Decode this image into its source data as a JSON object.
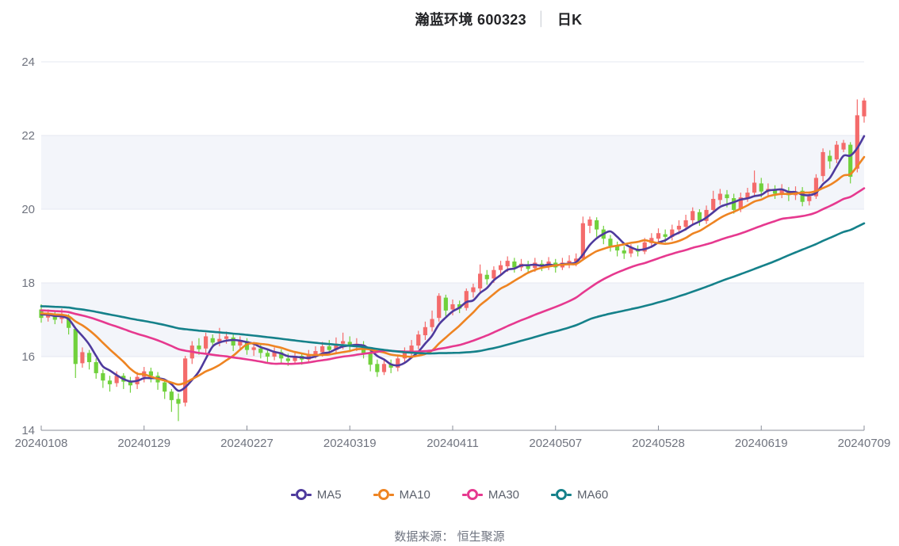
{
  "title": {
    "stock": "瀚蓝环境 600323",
    "separator": "│",
    "period": "日K"
  },
  "footer": {
    "source_label": "数据来源： 恒生聚源"
  },
  "legend": {
    "items": [
      {
        "label": "MA5",
        "color": "#4e3a9d"
      },
      {
        "label": "MA10",
        "color": "#ee8422"
      },
      {
        "label": "MA30",
        "color": "#e6398f"
      },
      {
        "label": "MA60",
        "color": "#15818a"
      }
    ]
  },
  "chart_data": {
    "type": "candlestick",
    "title": "瀚蓝环境 600323 日K",
    "legend_entries": [
      "MA5",
      "MA10",
      "MA30",
      "MA60"
    ],
    "y_axis": {
      "min": 14,
      "max": 24,
      "ticks": [
        14,
        16,
        18,
        20,
        22,
        24
      ],
      "tick_labels": [
        "14",
        "16",
        "18",
        "20",
        "22",
        "24"
      ]
    },
    "x_axis": {
      "tick_labels": [
        "20240108",
        "20240129",
        "20240227",
        "20240319",
        "20240411",
        "20240507",
        "20240528",
        "20240619",
        "20240709"
      ],
      "tick_indices": [
        0,
        15,
        30,
        45,
        60,
        75,
        90,
        105,
        120
      ]
    },
    "stripe_bands": [
      [
        16,
        18
      ],
      [
        20,
        22
      ]
    ],
    "grid_on": true,
    "legend_position": "bottom",
    "colors": {
      "up": "#f46b6b",
      "down": "#70d13c",
      "stripe": "#f3f5fa",
      "grid": "#e4e8f1",
      "axis": "#898e99",
      "label": "#70747f"
    },
    "candles_format": [
      "open",
      "close",
      "low",
      "high"
    ],
    "candles": [
      [
        17.28,
        17.05,
        16.92,
        17.42
      ],
      [
        17.06,
        17.15,
        16.95,
        17.28
      ],
      [
        17.15,
        17.0,
        16.88,
        17.22
      ],
      [
        17.02,
        17.1,
        16.9,
        17.3
      ],
      [
        17.08,
        16.78,
        16.6,
        17.15
      ],
      [
        16.75,
        15.8,
        15.42,
        16.8
      ],
      [
        15.82,
        16.12,
        15.7,
        16.25
      ],
      [
        16.1,
        15.85,
        15.65,
        16.18
      ],
      [
        15.85,
        15.55,
        15.4,
        15.95
      ],
      [
        15.55,
        15.35,
        15.15,
        15.65
      ],
      [
        15.35,
        15.25,
        15.05,
        15.48
      ],
      [
        15.28,
        15.48,
        15.18,
        15.6
      ],
      [
        15.48,
        15.32,
        15.12,
        15.55
      ],
      [
        15.32,
        15.22,
        15.02,
        15.45
      ],
      [
        15.25,
        15.45,
        15.12,
        15.58
      ],
      [
        15.45,
        15.6,
        15.3,
        15.72
      ],
      [
        15.6,
        15.48,
        15.3,
        15.7
      ],
      [
        15.48,
        15.3,
        15.1,
        15.58
      ],
      [
        15.3,
        15.05,
        14.85,
        15.4
      ],
      [
        15.05,
        14.82,
        14.5,
        15.12
      ],
      [
        14.85,
        14.72,
        14.25,
        15.0
      ],
      [
        14.75,
        15.95,
        14.65,
        16.02
      ],
      [
        15.95,
        16.3,
        15.8,
        16.42
      ],
      [
        16.3,
        16.2,
        16.05,
        16.5
      ],
      [
        16.22,
        16.55,
        16.1,
        16.65
      ],
      [
        16.5,
        16.38,
        16.25,
        16.6
      ],
      [
        16.4,
        16.48,
        16.28,
        16.78
      ],
      [
        16.48,
        16.55,
        16.35,
        16.68
      ],
      [
        16.52,
        16.3,
        16.15,
        16.6
      ],
      [
        16.3,
        16.45,
        16.2,
        16.55
      ],
      [
        16.42,
        16.18,
        16.05,
        16.5
      ],
      [
        16.18,
        16.25,
        16.02,
        16.4
      ],
      [
        16.22,
        16.1,
        15.95,
        16.32
      ],
      [
        16.1,
        16.0,
        15.85,
        16.22
      ],
      [
        16.0,
        16.12,
        15.9,
        16.25
      ],
      [
        16.12,
        15.95,
        15.8,
        16.2
      ],
      [
        15.95,
        15.88,
        15.75,
        16.08
      ],
      [
        15.88,
        16.02,
        15.8,
        16.12
      ],
      [
        16.02,
        15.92,
        15.78,
        16.1
      ],
      [
        15.92,
        16.05,
        15.82,
        16.18
      ],
      [
        16.05,
        16.15,
        15.95,
        16.28
      ],
      [
        16.12,
        16.28,
        16.0,
        16.4
      ],
      [
        16.28,
        16.18,
        16.05,
        16.45
      ],
      [
        16.18,
        16.35,
        16.08,
        16.52
      ],
      [
        16.35,
        16.42,
        16.2,
        16.65
      ],
      [
        16.4,
        16.28,
        16.12,
        16.55
      ],
      [
        16.28,
        16.35,
        16.15,
        16.5
      ],
      [
        16.32,
        16.1,
        15.95,
        16.42
      ],
      [
        16.1,
        15.78,
        15.6,
        16.18
      ],
      [
        15.8,
        15.58,
        15.45,
        15.92
      ],
      [
        15.58,
        15.8,
        15.5,
        15.95
      ],
      [
        15.8,
        15.7,
        15.55,
        15.92
      ],
      [
        15.7,
        15.95,
        15.6,
        16.05
      ],
      [
        15.95,
        16.12,
        15.85,
        16.25
      ],
      [
        16.12,
        16.3,
        16.0,
        16.45
      ],
      [
        16.3,
        16.6,
        16.2,
        16.7
      ],
      [
        16.58,
        16.8,
        16.45,
        16.95
      ],
      [
        16.8,
        17.02,
        16.68,
        17.25
      ],
      [
        17.05,
        17.65,
        16.95,
        17.72
      ],
      [
        17.6,
        17.25,
        17.1,
        17.68
      ],
      [
        17.28,
        17.42,
        17.12,
        17.55
      ],
      [
        17.42,
        17.3,
        17.18,
        17.52
      ],
      [
        17.32,
        17.78,
        17.25,
        17.85
      ],
      [
        17.75,
        17.88,
        17.6,
        17.98
      ],
      [
        17.85,
        18.25,
        17.75,
        18.5
      ],
      [
        18.22,
        18.1,
        17.95,
        18.35
      ],
      [
        18.12,
        18.35,
        18.0,
        18.45
      ],
      [
        18.35,
        18.48,
        18.22,
        18.6
      ],
      [
        18.45,
        18.6,
        18.3,
        18.72
      ],
      [
        18.58,
        18.42,
        18.28,
        18.68
      ],
      [
        18.42,
        18.52,
        18.32,
        18.65
      ],
      [
        18.5,
        18.38,
        18.25,
        18.6
      ],
      [
        18.4,
        18.55,
        18.3,
        18.68
      ],
      [
        18.52,
        18.45,
        18.32,
        18.62
      ],
      [
        18.45,
        18.58,
        18.35,
        18.7
      ],
      [
        18.55,
        18.42,
        18.28,
        18.65
      ],
      [
        18.42,
        18.55,
        18.35,
        18.68
      ],
      [
        18.52,
        18.6,
        18.4,
        18.75
      ],
      [
        18.58,
        18.66,
        18.45,
        18.8
      ],
      [
        18.66,
        19.62,
        18.6,
        19.8
      ],
      [
        19.55,
        19.72,
        19.35,
        19.8
      ],
      [
        19.7,
        19.45,
        19.25,
        19.78
      ],
      [
        19.45,
        19.2,
        19.05,
        19.55
      ],
      [
        19.2,
        19.0,
        18.85,
        19.3
      ],
      [
        19.0,
        18.88,
        18.72,
        19.12
      ],
      [
        18.88,
        18.8,
        18.65,
        19.0
      ],
      [
        18.8,
        18.95,
        18.7,
        19.05
      ],
      [
        18.92,
        18.85,
        18.72,
        19.02
      ],
      [
        18.85,
        19.1,
        18.78,
        19.22
      ],
      [
        19.08,
        19.22,
        18.95,
        19.35
      ],
      [
        19.2,
        19.35,
        19.08,
        19.48
      ],
      [
        19.32,
        19.25,
        19.1,
        19.45
      ],
      [
        19.25,
        19.45,
        19.15,
        19.58
      ],
      [
        19.45,
        19.55,
        19.32,
        19.7
      ],
      [
        19.52,
        19.7,
        19.42,
        19.85
      ],
      [
        19.7,
        19.95,
        19.6,
        20.05
      ],
      [
        19.92,
        19.68,
        19.55,
        20.0
      ],
      [
        19.68,
        19.98,
        19.6,
        20.1
      ],
      [
        19.98,
        20.28,
        19.9,
        20.5
      ],
      [
        20.25,
        20.42,
        20.12,
        20.55
      ],
      [
        20.4,
        20.3,
        20.05,
        20.52
      ],
      [
        20.3,
        19.98,
        19.88,
        20.42
      ],
      [
        20.0,
        20.32,
        19.92,
        20.45
      ],
      [
        20.3,
        20.45,
        20.2,
        20.58
      ],
      [
        20.45,
        20.72,
        20.35,
        21.05
      ],
      [
        20.7,
        20.48,
        20.32,
        20.85
      ],
      [
        20.48,
        20.55,
        20.35,
        20.7
      ],
      [
        20.55,
        20.42,
        20.28,
        20.65
      ],
      [
        20.42,
        20.52,
        20.3,
        20.68
      ],
      [
        20.5,
        20.38,
        20.22,
        20.6
      ],
      [
        20.38,
        20.45,
        20.25,
        20.62
      ],
      [
        20.5,
        20.2,
        20.08,
        20.6
      ],
      [
        20.22,
        20.35,
        20.1,
        20.48
      ],
      [
        20.35,
        20.85,
        20.28,
        20.95
      ],
      [
        20.9,
        21.55,
        20.75,
        21.65
      ],
      [
        21.45,
        21.3,
        21.1,
        21.6
      ],
      [
        21.35,
        21.75,
        21.25,
        21.85
      ],
      [
        21.62,
        21.8,
        21.55,
        21.88
      ],
      [
        21.75,
        20.88,
        20.7,
        21.82
      ],
      [
        21.1,
        22.55,
        21.0,
        22.98
      ],
      [
        22.52,
        22.95,
        22.35,
        23.02
      ]
    ],
    "ma_windows": {
      "MA5": 5,
      "MA10": 10,
      "MA30": 30,
      "MA60": 60
    },
    "seed_closes_before_window": [
      17.6,
      17.59,
      17.58,
      17.58,
      17.57,
      17.56,
      17.55,
      17.55,
      17.54,
      17.53,
      17.52,
      17.52,
      17.51,
      17.5,
      17.49,
      17.49,
      17.48,
      17.47,
      17.46,
      17.46,
      17.45,
      17.44,
      17.43,
      17.43,
      17.42,
      17.41,
      17.4,
      17.4,
      17.39,
      17.38,
      17.37,
      17.37,
      17.36,
      17.35,
      17.34,
      17.34,
      17.33,
      17.32,
      17.31,
      17.31,
      17.3,
      17.29,
      17.28,
      17.28,
      17.27,
      17.26,
      17.25,
      17.25,
      17.24,
      17.23,
      17.22,
      17.22,
      17.21,
      17.2,
      17.19,
      17.19,
      17.18,
      17.17,
      17.16,
      17.16
    ]
  }
}
